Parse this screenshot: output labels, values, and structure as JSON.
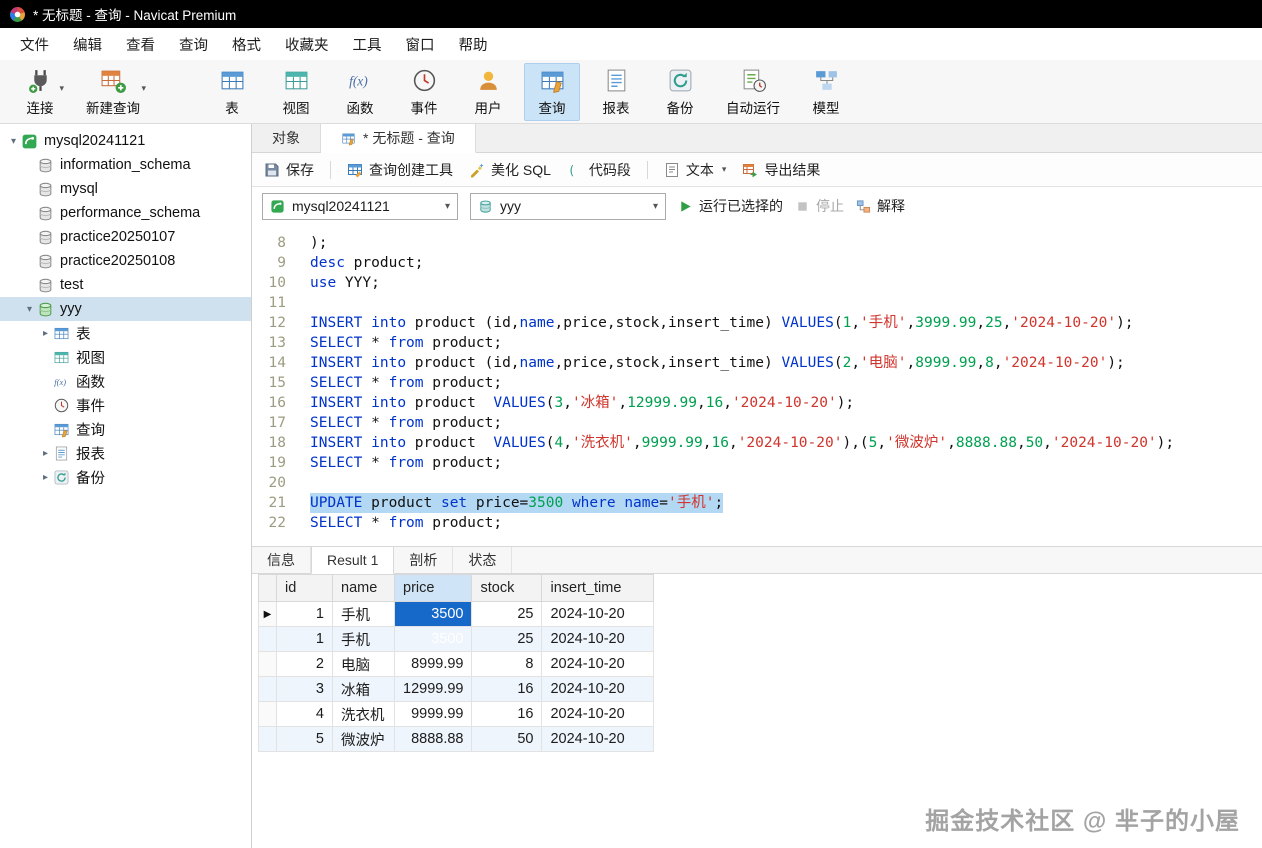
{
  "window": {
    "title": "* 无标题 - 查询 - Navicat Premium"
  },
  "menubar": {
    "items": [
      {
        "name": "file",
        "label": "文件"
      },
      {
        "name": "edit",
        "label": "编辑"
      },
      {
        "name": "view",
        "label": "查看"
      },
      {
        "name": "query",
        "label": "查询"
      },
      {
        "name": "format",
        "label": "格式"
      },
      {
        "name": "favorites",
        "label": "收藏夹"
      },
      {
        "name": "tools",
        "label": "工具"
      },
      {
        "name": "window",
        "label": "窗口"
      },
      {
        "name": "help",
        "label": "帮助"
      }
    ]
  },
  "toolbar": {
    "items": [
      {
        "name": "connection",
        "label": "连接",
        "icon": "connection",
        "caret": true
      },
      {
        "name": "new-query",
        "label": "新建查询",
        "icon": "new-query",
        "caret": true,
        "gap_after": true
      },
      {
        "name": "table",
        "label": "表",
        "icon": "table"
      },
      {
        "name": "view",
        "label": "视图",
        "icon": "view"
      },
      {
        "name": "function",
        "label": "函数",
        "icon": "function"
      },
      {
        "name": "event",
        "label": "事件",
        "icon": "event"
      },
      {
        "name": "user",
        "label": "用户",
        "icon": "user"
      },
      {
        "name": "query",
        "label": "查询",
        "icon": "query",
        "active": true
      },
      {
        "name": "report",
        "label": "报表",
        "icon": "report"
      },
      {
        "name": "backup",
        "label": "备份",
        "icon": "backup"
      },
      {
        "name": "automation",
        "label": "自动运行",
        "icon": "automation"
      },
      {
        "name": "model",
        "label": "模型",
        "icon": "model"
      }
    ]
  },
  "sidebar": {
    "items": [
      {
        "name": "connection-mysql20241121",
        "label": "mysql20241121",
        "icon": "conn-green",
        "depth": 0,
        "arrow": "down"
      },
      {
        "name": "db-information-schema",
        "label": "information_schema",
        "icon": "db-gray",
        "depth": 1
      },
      {
        "name": "db-mysql",
        "label": "mysql",
        "icon": "db-gray",
        "depth": 1
      },
      {
        "name": "db-performance-schema",
        "label": "performance_schema",
        "icon": "db-gray",
        "depth": 1
      },
      {
        "name": "db-practice20250107",
        "label": "practice20250107",
        "icon": "db-gray",
        "depth": 1
      },
      {
        "name": "db-practice20250108",
        "label": "practice20250108",
        "icon": "db-gray",
        "depth": 1
      },
      {
        "name": "db-test",
        "label": "test",
        "icon": "db-gray",
        "depth": 1
      },
      {
        "name": "db-yyy",
        "label": "yyy",
        "icon": "db-green",
        "depth": 1,
        "arrow": "down",
        "selected": true
      },
      {
        "name": "yyy-tables",
        "label": "表",
        "icon": "table",
        "depth": 2,
        "arrow": "right"
      },
      {
        "name": "yyy-views",
        "label": "视图",
        "icon": "view",
        "depth": 2
      },
      {
        "name": "yyy-functions",
        "label": "函数",
        "icon": "function",
        "depth": 2
      },
      {
        "name": "yyy-events",
        "label": "事件",
        "icon": "event",
        "depth": 2
      },
      {
        "name": "yyy-queries",
        "label": "查询",
        "icon": "query",
        "depth": 2
      },
      {
        "name": "yyy-reports",
        "label": "报表",
        "icon": "report",
        "depth": 2,
        "arrow": "right"
      },
      {
        "name": "yyy-backups",
        "label": "备份",
        "icon": "backup",
        "depth": 2,
        "arrow": "right"
      }
    ]
  },
  "doc_tabs": [
    {
      "name": "tab-objects",
      "label": "对象"
    },
    {
      "name": "tab-query",
      "label": "* 无标题 - 查询",
      "icon": "query",
      "active": true
    }
  ],
  "query_toolbar": {
    "buttons": [
      {
        "name": "save",
        "label": "保存",
        "icon": "save"
      },
      {
        "name": "query-builder",
        "label": "查询创建工具",
        "icon": "builder",
        "sep_before": true
      },
      {
        "name": "beautify-sql",
        "label": "美化 SQL",
        "icon": "beautify"
      },
      {
        "name": "code-snippet",
        "label": "代码段",
        "icon": "snippet"
      },
      {
        "name": "text",
        "label": "文本",
        "icon": "text",
        "caret": true,
        "sep_before": true
      },
      {
        "name": "export-result",
        "label": "导出结果",
        "icon": "export"
      }
    ]
  },
  "run_bar": {
    "connection": {
      "value": "mysql20241121",
      "icon": "conn-green"
    },
    "database": {
      "value": "yyy",
      "icon": "db-teal"
    },
    "run": {
      "label": "运行已选择的"
    },
    "stop": {
      "label": "停止"
    },
    "explain": {
      "label": "解释"
    }
  },
  "editor": {
    "lines": [
      {
        "num": 8,
        "tokens": [
          [
            "p",
            ");"
          ]
        ]
      },
      {
        "num": 9,
        "tokens": [
          [
            "k",
            "desc"
          ],
          [
            "p",
            " product;"
          ]
        ]
      },
      {
        "num": 10,
        "tokens": [
          [
            "k",
            "use"
          ],
          [
            "p",
            " YYY;"
          ]
        ]
      },
      {
        "num": 11,
        "tokens": []
      },
      {
        "num": 12,
        "tokens": [
          [
            "k",
            "INSERT"
          ],
          [
            "p",
            " "
          ],
          [
            "k",
            "into"
          ],
          [
            "p",
            " product (id,"
          ],
          [
            "k",
            "name"
          ],
          [
            "p",
            ",price,stock,insert_time) "
          ],
          [
            "k",
            "VALUES"
          ],
          [
            "p",
            "("
          ],
          [
            "n",
            "1"
          ],
          [
            "p",
            ","
          ],
          [
            "s",
            "'手机'"
          ],
          [
            "p",
            ","
          ],
          [
            "n",
            "3999.99"
          ],
          [
            "p",
            ","
          ],
          [
            "n",
            "25"
          ],
          [
            "p",
            ","
          ],
          [
            "s",
            "'2024-10-20'"
          ],
          [
            "p",
            ");"
          ]
        ]
      },
      {
        "num": 13,
        "tokens": [
          [
            "k",
            "SELECT"
          ],
          [
            "p",
            " * "
          ],
          [
            "k",
            "from"
          ],
          [
            "p",
            " product;"
          ]
        ]
      },
      {
        "num": 14,
        "tokens": [
          [
            "k",
            "INSERT"
          ],
          [
            "p",
            " "
          ],
          [
            "k",
            "into"
          ],
          [
            "p",
            " product (id,"
          ],
          [
            "k",
            "name"
          ],
          [
            "p",
            ",price,stock,insert_time) "
          ],
          [
            "k",
            "VALUES"
          ],
          [
            "p",
            "("
          ],
          [
            "n",
            "2"
          ],
          [
            "p",
            ","
          ],
          [
            "s",
            "'电脑'"
          ],
          [
            "p",
            ","
          ],
          [
            "n",
            "8999.99"
          ],
          [
            "p",
            ","
          ],
          [
            "n",
            "8"
          ],
          [
            "p",
            ","
          ],
          [
            "s",
            "'2024-10-20'"
          ],
          [
            "p",
            ");"
          ]
        ]
      },
      {
        "num": 15,
        "tokens": [
          [
            "k",
            "SELECT"
          ],
          [
            "p",
            " * "
          ],
          [
            "k",
            "from"
          ],
          [
            "p",
            " product;"
          ]
        ]
      },
      {
        "num": 16,
        "tokens": [
          [
            "k",
            "INSERT"
          ],
          [
            "p",
            " "
          ],
          [
            "k",
            "into"
          ],
          [
            "p",
            " product  "
          ],
          [
            "k",
            "VALUES"
          ],
          [
            "p",
            "("
          ],
          [
            "n",
            "3"
          ],
          [
            "p",
            ","
          ],
          [
            "s",
            "'冰箱'"
          ],
          [
            "p",
            ","
          ],
          [
            "n",
            "12999.99"
          ],
          [
            "p",
            ","
          ],
          [
            "n",
            "16"
          ],
          [
            "p",
            ","
          ],
          [
            "s",
            "'2024-10-20'"
          ],
          [
            "p",
            ");"
          ]
        ]
      },
      {
        "num": 17,
        "tokens": [
          [
            "k",
            "SELECT"
          ],
          [
            "p",
            " * "
          ],
          [
            "k",
            "from"
          ],
          [
            "p",
            " product;"
          ]
        ]
      },
      {
        "num": 18,
        "tokens": [
          [
            "k",
            "INSERT"
          ],
          [
            "p",
            " "
          ],
          [
            "k",
            "into"
          ],
          [
            "p",
            " product  "
          ],
          [
            "k",
            "VALUES"
          ],
          [
            "p",
            "("
          ],
          [
            "n",
            "4"
          ],
          [
            "p",
            ","
          ],
          [
            "s",
            "'洗衣机'"
          ],
          [
            "p",
            ","
          ],
          [
            "n",
            "9999.99"
          ],
          [
            "p",
            ","
          ],
          [
            "n",
            "16"
          ],
          [
            "p",
            ","
          ],
          [
            "s",
            "'2024-10-20'"
          ],
          [
            "p",
            "),("
          ],
          [
            "n",
            "5"
          ],
          [
            "p",
            ","
          ],
          [
            "s",
            "'微波炉'"
          ],
          [
            "p",
            ","
          ],
          [
            "n",
            "8888.88"
          ],
          [
            "p",
            ","
          ],
          [
            "n",
            "50"
          ],
          [
            "p",
            ","
          ],
          [
            "s",
            "'2024-10-20'"
          ],
          [
            "p",
            ");"
          ]
        ]
      },
      {
        "num": 19,
        "tokens": [
          [
            "k",
            "SELECT"
          ],
          [
            "p",
            " * "
          ],
          [
            "k",
            "from"
          ],
          [
            "p",
            " product;"
          ]
        ]
      },
      {
        "num": 20,
        "tokens": []
      },
      {
        "num": 21,
        "selected": true,
        "tokens": [
          [
            "k",
            "UPDATE"
          ],
          [
            "p",
            " product "
          ],
          [
            "k",
            "set"
          ],
          [
            "p",
            " price="
          ],
          [
            "n",
            "3500"
          ],
          [
            "p",
            " "
          ],
          [
            "k",
            "where"
          ],
          [
            "p",
            " "
          ],
          [
            "k",
            "name"
          ],
          [
            "p",
            "="
          ],
          [
            "s",
            "'手机'"
          ],
          [
            "p",
            ";"
          ]
        ]
      },
      {
        "num": 22,
        "tokens": [
          [
            "k",
            "SELECT"
          ],
          [
            "p",
            " * "
          ],
          [
            "k",
            "from"
          ],
          [
            "p",
            " product;"
          ]
        ]
      }
    ]
  },
  "result": {
    "tabs": [
      {
        "name": "info",
        "label": "信息"
      },
      {
        "name": "result-1",
        "label": "Result 1",
        "active": true
      },
      {
        "name": "profile",
        "label": "剖析"
      },
      {
        "name": "status",
        "label": "状态"
      }
    ],
    "columns": [
      "id",
      "name",
      "price",
      "stock",
      "insert_time"
    ],
    "selected_column": "price",
    "rows": [
      {
        "cells": [
          "1",
          "手机",
          "3500",
          "25",
          "2024-10-20"
        ],
        "current": true,
        "price_selected": true
      },
      {
        "cells": [
          "1",
          "手机",
          "3500",
          "25",
          "2024-10-20"
        ],
        "price_selected": true
      },
      {
        "cells": [
          "2",
          "电脑",
          "8999.99",
          "8",
          "2024-10-20"
        ]
      },
      {
        "cells": [
          "3",
          "冰箱",
          "12999.99",
          "16",
          "2024-10-20"
        ]
      },
      {
        "cells": [
          "4",
          "洗衣机",
          "9999.99",
          "16",
          "2024-10-20"
        ]
      },
      {
        "cells": [
          "5",
          "微波炉",
          "8888.88",
          "50",
          "2024-10-20"
        ]
      }
    ]
  },
  "watermark": "掘金技术社区 @ 芈子的小屋",
  "colors": {
    "accent": "#1769c9",
    "keyword": "#0033cc",
    "string": "#d0342c",
    "number": "#00a050",
    "selection": "#b3d8f3",
    "tree_selection": "#cfe0ee",
    "toolbar_active": "#cbe3f7"
  }
}
